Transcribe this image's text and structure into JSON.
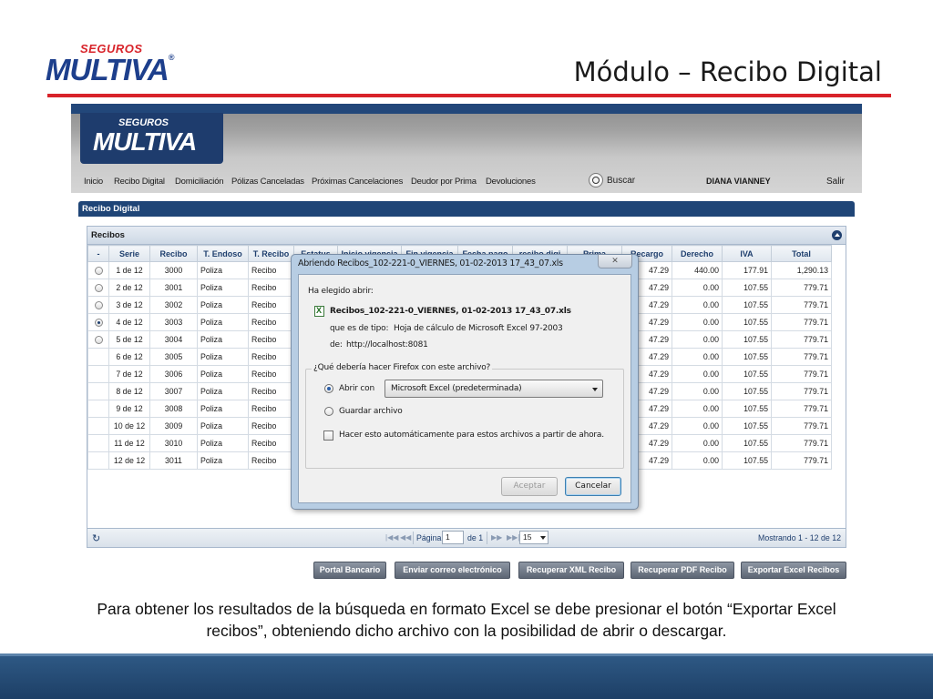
{
  "slide": {
    "logo_top": "SEGUROS",
    "logo_main": "MULTIVA",
    "title": "Módulo – Recibo Digital",
    "caption_line1": "Para obtener los resultados de la búsqueda en formato Excel se debe presionar el botón “Exportar Excel",
    "caption_line2": "recibos”, obteniendo dicho archivo con la posibilidad de abrir o descargar.",
    "accent_color": "#d8232a",
    "brand_color": "#1d3f8c"
  },
  "app": {
    "logo_top": "SEGUROS",
    "logo_main": "MULTIVA",
    "nav": [
      "Inicio",
      "Recibo Digital",
      "Domiciliación",
      "Pólizas Canceladas",
      "Próximas Cancelaciones",
      "Deudor por Prima",
      "Devoluciones"
    ],
    "search_label": "Buscar",
    "user_name": "DIANA VIANNEY",
    "exit_label": "Salir",
    "section_title": "Recibo Digital",
    "grid_title": "Recibos",
    "columns": [
      "-",
      "Serie",
      "Recibo",
      "T. Endoso",
      "T. Recibo",
      "Estatus",
      "Inicio vigencia",
      "Fin vigencia",
      "Fecha pago",
      "recibo digi",
      "Prima",
      "Recargo",
      "Derecho",
      "IVA",
      "Total"
    ],
    "rows": [
      {
        "radio": true,
        "selected": false,
        "serie": "1 de 12",
        "recibo": "3000",
        "endoso": "Poliza",
        "tipo": "Recibo",
        "recargo": "47.29",
        "derecho": "440.00",
        "iva": "177.91",
        "total": "1,290.13"
      },
      {
        "radio": true,
        "selected": false,
        "serie": "2 de 12",
        "recibo": "3001",
        "endoso": "Poliza",
        "tipo": "Recibo",
        "recargo": "47.29",
        "derecho": "0.00",
        "iva": "107.55",
        "total": "779.71"
      },
      {
        "radio": true,
        "selected": false,
        "serie": "3 de 12",
        "recibo": "3002",
        "endoso": "Poliza",
        "tipo": "Recibo",
        "recargo": "47.29",
        "derecho": "0.00",
        "iva": "107.55",
        "total": "779.71"
      },
      {
        "radio": true,
        "selected": true,
        "serie": "4 de 12",
        "recibo": "3003",
        "endoso": "Poliza",
        "tipo": "Recibo",
        "recargo": "47.29",
        "derecho": "0.00",
        "iva": "107.55",
        "total": "779.71"
      },
      {
        "radio": true,
        "selected": false,
        "serie": "5 de 12",
        "recibo": "3004",
        "endoso": "Poliza",
        "tipo": "Recibo",
        "recargo": "47.29",
        "derecho": "0.00",
        "iva": "107.55",
        "total": "779.71"
      },
      {
        "radio": false,
        "selected": false,
        "serie": "6 de 12",
        "recibo": "3005",
        "endoso": "Poliza",
        "tipo": "Recibo",
        "recargo": "47.29",
        "derecho": "0.00",
        "iva": "107.55",
        "total": "779.71"
      },
      {
        "radio": false,
        "selected": false,
        "serie": "7 de 12",
        "recibo": "3006",
        "endoso": "Poliza",
        "tipo": "Recibo",
        "recargo": "47.29",
        "derecho": "0.00",
        "iva": "107.55",
        "total": "779.71"
      },
      {
        "radio": false,
        "selected": false,
        "serie": "8 de 12",
        "recibo": "3007",
        "endoso": "Poliza",
        "tipo": "Recibo",
        "recargo": "47.29",
        "derecho": "0.00",
        "iva": "107.55",
        "total": "779.71"
      },
      {
        "radio": false,
        "selected": false,
        "serie": "9 de 12",
        "recibo": "3008",
        "endoso": "Poliza",
        "tipo": "Recibo",
        "recargo": "47.29",
        "derecho": "0.00",
        "iva": "107.55",
        "total": "779.71"
      },
      {
        "radio": false,
        "selected": false,
        "serie": "10 de 12",
        "recibo": "3009",
        "endoso": "Poliza",
        "tipo": "Recibo",
        "recargo": "47.29",
        "derecho": "0.00",
        "iva": "107.55",
        "total": "779.71"
      },
      {
        "radio": false,
        "selected": false,
        "serie": "11 de 12",
        "recibo": "3010",
        "endoso": "Poliza",
        "tipo": "Recibo",
        "recargo": "47.29",
        "derecho": "0.00",
        "iva": "107.55",
        "total": "779.71"
      },
      {
        "radio": false,
        "selected": false,
        "serie": "12 de 12",
        "recibo": "3011",
        "endoso": "Poliza",
        "tipo": "Recibo",
        "recargo": "47.29",
        "derecho": "0.00",
        "iva": "107.55",
        "total": "779.71"
      }
    ],
    "pager": {
      "page_label": "Página",
      "page_value": "1",
      "of_label": "de 1",
      "page_size": "15",
      "status": "Mostrando 1 - 12 de 12"
    },
    "actions": [
      "Portal Bancario",
      "Enviar correo electrónico",
      "Recuperar XML Recibo",
      "Recuperar PDF Recibo",
      "Exportar Excel Recibos"
    ]
  },
  "dialog": {
    "title": "Abriendo Recibos_102-221-0_VIERNES, 01-02-2013 17_43_07.xls",
    "intro": "Ha elegido abrir:",
    "filename": "Recibos_102-221-0_VIERNES, 01-02-2013 17_43_07.xls",
    "type_label": "que es de tipo:",
    "type_value": "Hoja de cálculo de Microsoft Excel 97-2003",
    "from_label": "de:",
    "from_value": "http://localhost:8081",
    "question": "¿Qué debería hacer Firefox con este archivo?",
    "open_with_label": "Abrir con",
    "open_with_value": "Microsoft Excel (predeterminada)",
    "save_label": "Guardar archivo",
    "auto_label": "Hacer esto automáticamente para estos archivos a partir de ahora.",
    "accept_label": "Aceptar",
    "cancel_label": "Cancelar"
  }
}
